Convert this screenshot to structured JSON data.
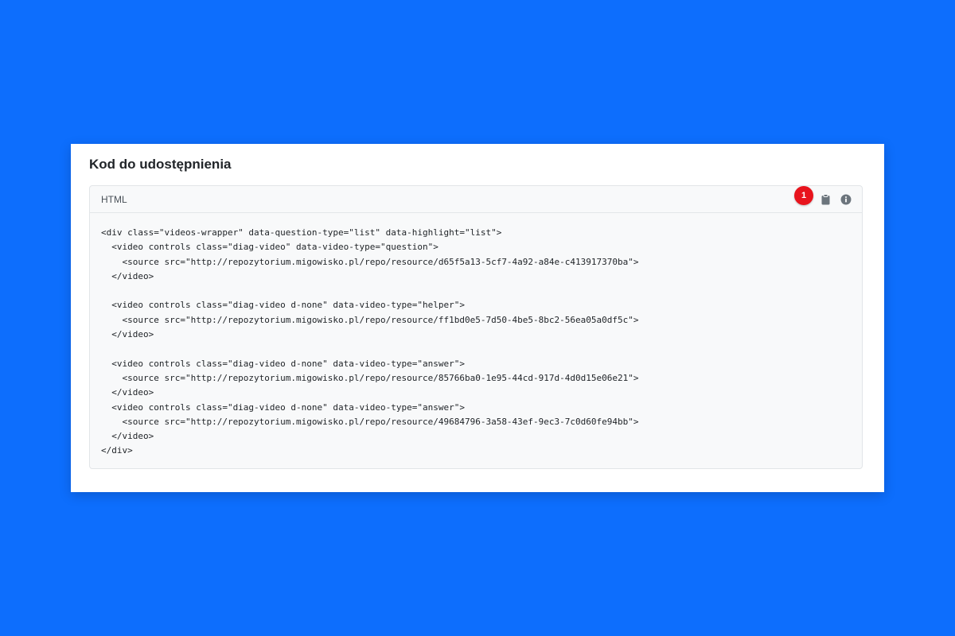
{
  "panel": {
    "title": "Kod do udostępnienia",
    "code_block": {
      "language_label": "HTML",
      "badge_count": "1",
      "copy_icon": "clipboard-icon",
      "info_icon": "info-circle-icon",
      "lines": [
        "<div class=\"videos-wrapper\" data-question-type=\"list\" data-highlight=\"list\">",
        "  <video controls class=\"diag-video\" data-video-type=\"question\">",
        "    <source src=\"http://repozytorium.migowisko.pl/repo/resource/d65f5a13-5cf7-4a92-a84e-c413917370ba\">",
        "  </video>",
        "",
        "  <video controls class=\"diag-video d-none\" data-video-type=\"helper\">",
        "    <source src=\"http://repozytorium.migowisko.pl/repo/resource/ff1bd0e5-7d50-4be5-8bc2-56ea05a0df5c\">",
        "  </video>",
        "",
        "  <video controls class=\"diag-video d-none\" data-video-type=\"answer\">",
        "    <source src=\"http://repozytorium.migowisko.pl/repo/resource/85766ba0-1e95-44cd-917d-4d0d15e06e21\">",
        "  </video>",
        "  <video controls class=\"diag-video d-none\" data-video-type=\"answer\">",
        "    <source src=\"http://repozytorium.migowisko.pl/repo/resource/49684796-3a58-43ef-9ec3-7c0d60fe94bb\">",
        "  </video>",
        "</div>"
      ]
    }
  },
  "colors": {
    "background": "#0d6efd",
    "badge": "#e8141d",
    "icon": "#6c757d"
  }
}
